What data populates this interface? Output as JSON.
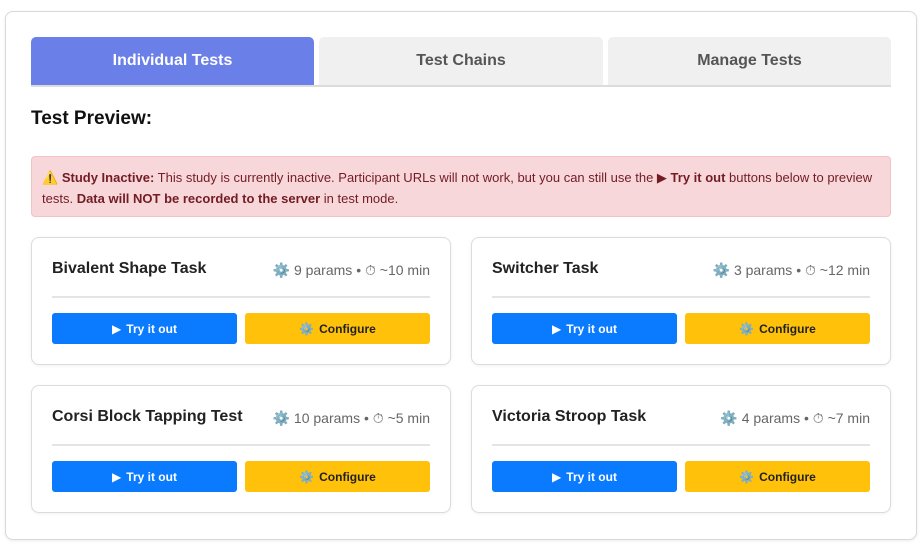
{
  "tabs": [
    {
      "label": "Individual Tests",
      "active": true
    },
    {
      "label": "Test Chains",
      "active": false
    },
    {
      "label": "Manage Tests",
      "active": false
    }
  ],
  "preview": {
    "title": "Test Preview:"
  },
  "alert": {
    "icon": "⚠️",
    "heading": "Study Inactive:",
    "text1": " This study is currently inactive. Participant URLs will not work, but you can still use the ",
    "try_label": "▶ Try it out",
    "text2": " buttons below to preview tests. ",
    "bold_warning": "Data will NOT be recorded to the server",
    "text3": " in test mode."
  },
  "cards": [
    {
      "title": "Bivalent Shape Task",
      "params": "9 params",
      "duration": "~10 min"
    },
    {
      "title": "Switcher Task",
      "params": "3 params",
      "duration": "~12 min"
    },
    {
      "title": "Corsi Block Tapping Test",
      "params": "10 params",
      "duration": "~5 min"
    },
    {
      "title": "Victoria Stroop Task",
      "params": "4 params",
      "duration": "~7 min"
    }
  ],
  "buttons": {
    "try_label": "Try it out",
    "configure_label": "Configure"
  },
  "icons": {
    "gear": "⚙️",
    "timer": "⏱",
    "play": "▶",
    "sep": "•"
  },
  "colors": {
    "tab_active": "#6a7fe8",
    "try": "#0a7bff",
    "configure": "#ffc10a",
    "alert_bg": "#f8d7da",
    "alert_text": "#721c24"
  }
}
